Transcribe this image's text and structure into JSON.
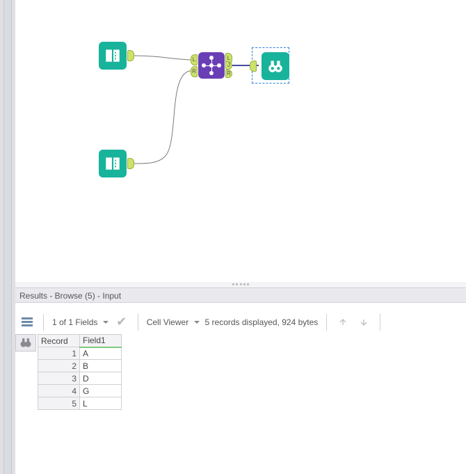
{
  "panel": {
    "title": "Results - Browse (5) - Input"
  },
  "toolbar": {
    "fields_label": "1 of 1 Fields",
    "viewer_label": "Cell Viewer",
    "status": "5 records displayed, 924 bytes"
  },
  "grid": {
    "columns": {
      "record": "Record",
      "field1": "Field1"
    },
    "rows": [
      {
        "n": "1",
        "v": "A"
      },
      {
        "n": "2",
        "v": "B"
      },
      {
        "n": "3",
        "v": "D"
      },
      {
        "n": "4",
        "v": "G"
      },
      {
        "n": "5",
        "v": "L"
      }
    ]
  },
  "ports": {
    "L": "L",
    "J": "J",
    "R": "R"
  }
}
